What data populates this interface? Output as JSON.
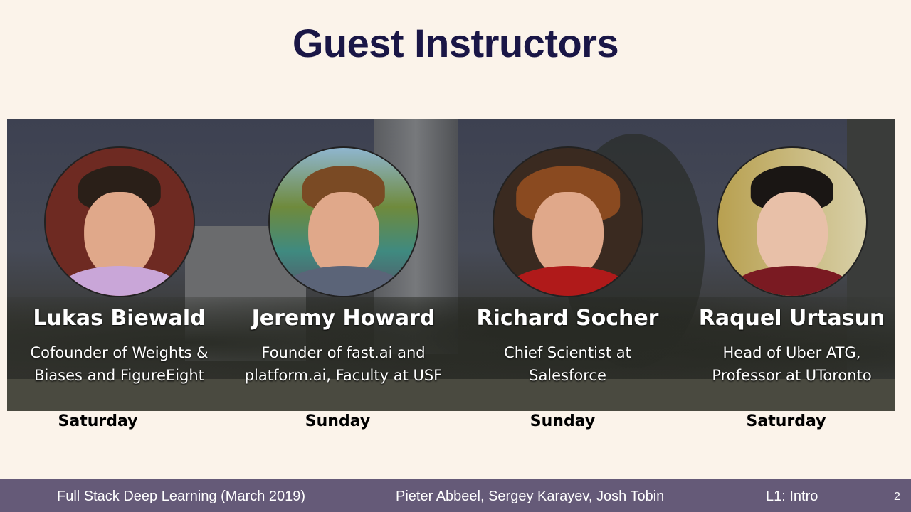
{
  "title": "Guest Instructors",
  "instructors": [
    {
      "name": "Lukas Biewald",
      "desc": [
        "Cofounder of Weights &",
        "Biases and FigureEight"
      ],
      "day": "Saturday"
    },
    {
      "name": "Jeremy Howard",
      "desc": [
        "Founder of fast.ai and",
        "platform.ai, Faculty at USF"
      ],
      "day": "Sunday"
    },
    {
      "name": "Richard Socher",
      "desc": [
        "Chief Scientist at",
        "Salesforce"
      ],
      "day": "Sunday"
    },
    {
      "name": "Raquel Urtasun",
      "desc": [
        "Head of Uber ATG,",
        "Professor at UToronto"
      ],
      "day": "Saturday"
    }
  ],
  "footer": {
    "course": "Full Stack Deep Learning (March 2019)",
    "authors": "Pieter Abbeel, Sergey Karayev, Josh Tobin",
    "lecture": "L1: Intro",
    "page": "2"
  },
  "colors": {
    "background": "#fbf3ea",
    "title": "#1a1646",
    "footer": "#655a78"
  }
}
